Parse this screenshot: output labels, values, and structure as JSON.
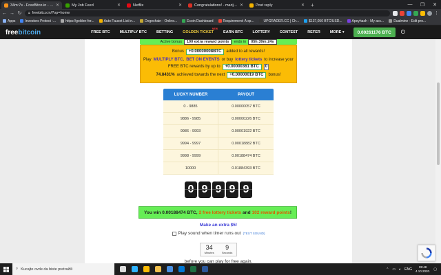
{
  "browser": {
    "tabs": [
      {
        "title": "34m:7s - FreeBitco.in - Win free",
        "color": "#f7931a",
        "active": true
      },
      {
        "title": "My Job Feed",
        "color": "#37a000",
        "active": false
      },
      {
        "title": "Netflix",
        "color": "#e50914",
        "active": false
      },
      {
        "title": "Congratulations! - marijana.niko",
        "color": "#d93025",
        "active": false
      },
      {
        "title": "Post reply",
        "color": "#f4b400",
        "active": false
      }
    ],
    "new_tab": "+",
    "window_controls": [
      "—",
      "❐",
      "✕"
    ],
    "url": "freebitco.in/?op=home",
    "bookmarks": [
      {
        "label": "Apps",
        "color": "#8ab4f8"
      },
      {
        "label": "Investors Protect -...",
        "color": "#4285f4"
      },
      {
        "label": "https://golden-fer...",
        "color": "#aaaaaa"
      },
      {
        "label": "Auto Faucet List in...",
        "color": "#f4b400"
      },
      {
        "label": "Dogechain - Online...",
        "color": "#c2a633"
      },
      {
        "label": "Ecoin Dashboard",
        "color": "#34a853"
      },
      {
        "label": "Requirement: A sp...",
        "color": "#ea4335"
      },
      {
        "label": "UPGRADER.CC | Ch...",
        "color": "#333333"
      },
      {
        "label": "$137,050 BTC/USD...",
        "color": "#1da1f2"
      },
      {
        "label": "Apeyhash - My acc...",
        "color": "#7b3fe4"
      },
      {
        "label": "Dualmine - Edit pro...",
        "color": "#999999"
      }
    ]
  },
  "site": {
    "logo_free": "free",
    "logo_btc": "bitcoin",
    "menu": [
      {
        "label": "FREE BTC",
        "style": "normal"
      },
      {
        "label": "MULTIPLY BTC",
        "style": "normal"
      },
      {
        "label": "BETTING",
        "style": "normal"
      },
      {
        "label": "GOLDEN TICKET",
        "style": "gold"
      },
      {
        "label": "EARN BTC",
        "style": "normal"
      },
      {
        "label": "LOTTERY",
        "style": "normal"
      },
      {
        "label": "CONTEST",
        "style": "normal"
      },
      {
        "label": "REFER",
        "style": "normal"
      },
      {
        "label": "MORE ▾",
        "style": "normal"
      }
    ],
    "new_badge": "NEW",
    "balance": "0.00261176 BTC"
  },
  "reward_banner": {
    "prefix": "Active bonus",
    "points": "100 extra reward points",
    "ends_label": "ends in",
    "ends_value": "05h:39m:24s"
  },
  "bonus_box": {
    "bonus_prefix": "Bonus",
    "bonus_value": "+0.00000008BTC",
    "bonus_suffix": "added to all rewards!",
    "play_text": "Play",
    "multiply_link": "MULTIPLY BTC",
    "comma": ",",
    "bet_link": "BET ON EVENTS",
    "or_buy": "or buy",
    "lottery_link": "lottery tickets",
    "increase_text": "to increase your",
    "free_rewards_text": "FREE BTC rewards by up to",
    "increase_value": "+0.00000361 BTC",
    "count_value": "0",
    "progress_pct": "74.8431%",
    "progress_text": "achieved towards the next",
    "next_bonus": "+0.00000019 BTC",
    "next_suffix": "bonus!"
  },
  "payout_table": {
    "headers": [
      "LUCKY NUMBER",
      "PAYOUT"
    ],
    "rows": [
      [
        "0 - 9885",
        "0.00000057 BTC"
      ],
      [
        "9886 - 9985",
        "0.00000226 BTC"
      ],
      [
        "9986 - 9993",
        "0.00001922 BTC"
      ],
      [
        "9994 - 9997",
        "0.00018882 BTC"
      ],
      [
        "9998 - 9999",
        "0.00188474 BTC"
      ],
      [
        "10000",
        "0.01884393 BTC"
      ]
    ]
  },
  "lucky_digits": [
    "0",
    "9",
    "9",
    "9",
    "9"
  ],
  "win": {
    "prefix": "You win 0.00188474 BTC,",
    "tickets": "2 free lottery tickets",
    "and": "and",
    "points": "102 reward points",
    "suffix": "!"
  },
  "extra_link": "Make an extra $5!",
  "sound": {
    "label": "Play sound when timer runs out",
    "test": "(TEST SOUND)"
  },
  "timer": {
    "minutes": "34",
    "minutes_label": "Minutes",
    "seconds": "9",
    "seconds_label": "Seconds"
  },
  "before_play": "before you can play for free again.",
  "taskbar": {
    "search_placeholder": "Kucajte ovde da biste pretražili",
    "apps": [
      {
        "name": "task-view",
        "color": "#dddddd"
      },
      {
        "name": "edge",
        "color": "#2fb3ff"
      },
      {
        "name": "chrome",
        "color": "#fbbc05"
      },
      {
        "name": "file-explorer",
        "color": "#f2c14e"
      },
      {
        "name": "store",
        "color": "#4a90e2"
      },
      {
        "name": "mail",
        "color": "#0078d4"
      },
      {
        "name": "excel",
        "color": "#1d6f42"
      },
      {
        "name": "word",
        "color": "#2b579a"
      }
    ],
    "lang": "ENG",
    "time": "09:48",
    "date": "4.10.2020."
  }
}
